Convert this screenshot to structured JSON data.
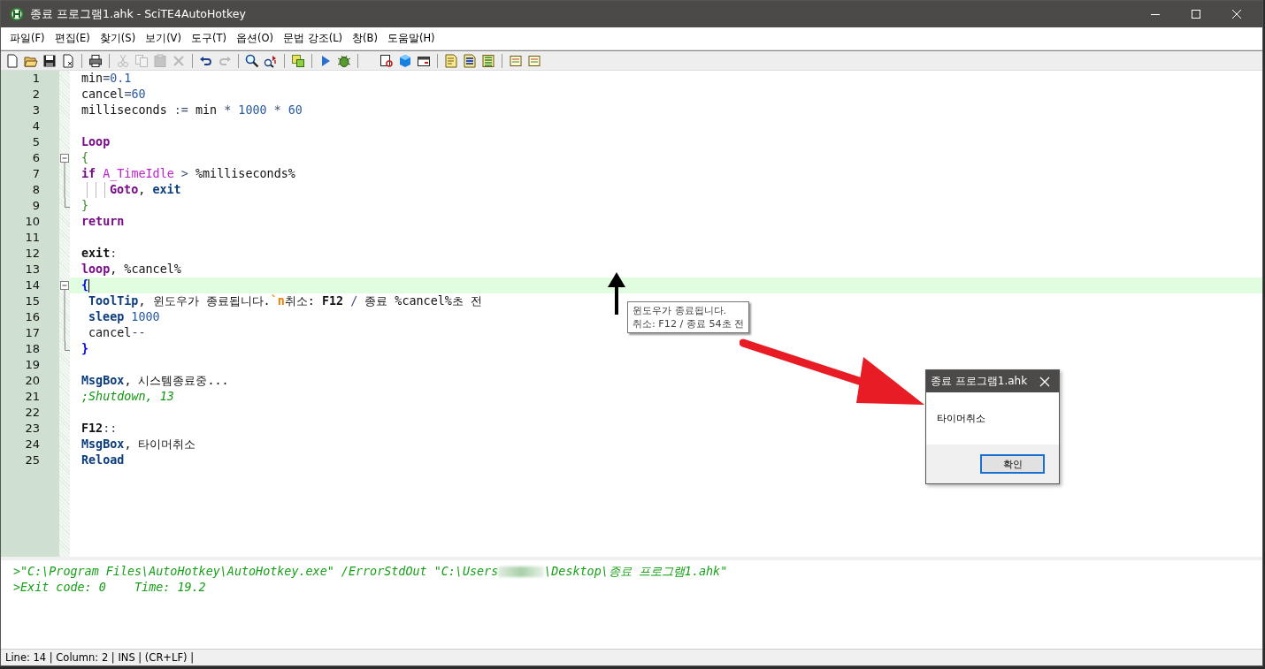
{
  "window": {
    "title": "종료 프로그램1.ahk - SciTE4AutoHotkey"
  },
  "menu": [
    "파일(F)",
    "편집(E)",
    "찾기(S)",
    "보기(V)",
    "도구(T)",
    "옵션(O)",
    "문법 강조(L)",
    "창(B)",
    "도움말(H)"
  ],
  "toolbar": [
    {
      "kind": "document",
      "disabled": false
    },
    {
      "kind": "folder",
      "disabled": false
    },
    {
      "kind": "floppy",
      "disabled": false
    },
    {
      "kind": "document-x",
      "disabled": false
    },
    {
      "kind": "separator"
    },
    {
      "kind": "printer",
      "disabled": false
    },
    {
      "kind": "separator"
    },
    {
      "kind": "scissors",
      "disabled": true
    },
    {
      "kind": "copy",
      "disabled": true
    },
    {
      "kind": "clipboard",
      "disabled": true
    },
    {
      "kind": "cross",
      "disabled": true
    },
    {
      "kind": "separator"
    },
    {
      "kind": "undo",
      "disabled": false
    },
    {
      "kind": "redo",
      "disabled": true
    },
    {
      "kind": "separator"
    },
    {
      "kind": "magnifier",
      "disabled": false
    },
    {
      "kind": "replace",
      "disabled": false
    },
    {
      "kind": "separator"
    },
    {
      "kind": "pages",
      "disabled": false
    },
    {
      "kind": "separator"
    },
    {
      "kind": "play",
      "disabled": false
    },
    {
      "kind": "bug",
      "disabled": false
    },
    {
      "kind": "separator"
    },
    {
      "kind": "gap"
    },
    {
      "kind": "page-magnifier",
      "disabled": false
    },
    {
      "kind": "cube",
      "disabled": false
    },
    {
      "kind": "card",
      "disabled": false
    },
    {
      "kind": "separator"
    },
    {
      "kind": "note",
      "disabled": false
    },
    {
      "kind": "note-lines",
      "disabled": false
    },
    {
      "kind": "note-list",
      "disabled": false
    },
    {
      "kind": "separator"
    },
    {
      "kind": "sheet",
      "disabled": false
    },
    {
      "kind": "sheet",
      "disabled": false
    }
  ],
  "editor": {
    "lines": [
      {
        "number": "1",
        "current": false,
        "segments": [
          {
            "kind": "plain",
            "text": "min"
          },
          {
            "kind": "op",
            "text": "="
          },
          {
            "kind": "number",
            "text": "0.1"
          }
        ]
      },
      {
        "number": "2",
        "current": false,
        "segments": [
          {
            "kind": "plain",
            "text": "cancel"
          },
          {
            "kind": "op",
            "text": "="
          },
          {
            "kind": "number",
            "text": "60"
          }
        ]
      },
      {
        "number": "3",
        "current": false,
        "segments": [
          {
            "kind": "plain",
            "text": "milliseconds "
          },
          {
            "kind": "op",
            "text": ":="
          },
          {
            "kind": "plain",
            "text": " min "
          },
          {
            "kind": "op",
            "text": "*"
          },
          {
            "kind": "number",
            "text": " 1000 "
          },
          {
            "kind": "op",
            "text": "*"
          },
          {
            "kind": "number",
            "text": " 60"
          }
        ]
      },
      {
        "number": "4",
        "current": false
      },
      {
        "number": "5",
        "current": false,
        "segments": [
          {
            "kind": "flow",
            "text": "Loop"
          }
        ]
      },
      {
        "number": "6",
        "fold_expanded": true,
        "current": false,
        "segments": [
          {
            "kind": "brace",
            "text": "{"
          }
        ]
      },
      {
        "number": "7",
        "fold_line": true,
        "current": false,
        "segments": [
          {
            "kind": "flow",
            "text": "if"
          },
          {
            "kind": "var",
            "text": " A_TimeIdle"
          },
          {
            "kind": "op",
            "text": " > "
          },
          {
            "kind": "plain",
            "text": "%milliseconds%"
          }
        ]
      },
      {
        "number": "8",
        "fold_line": true,
        "current": false,
        "guides": true,
        "segments": [
          {
            "kind": "flow",
            "text": "Goto"
          },
          {
            "kind": "plain",
            "text": ", "
          },
          {
            "kind": "command",
            "text": "exit"
          }
        ]
      },
      {
        "number": "9",
        "fold_end": true,
        "current": false,
        "segments": [
          {
            "kind": "brace",
            "text": "}"
          }
        ]
      },
      {
        "number": "10",
        "current": false,
        "segments": [
          {
            "kind": "flow",
            "text": "return"
          }
        ]
      },
      {
        "number": "11",
        "current": false
      },
      {
        "number": "12",
        "current": false,
        "segments": [
          {
            "kind": "label",
            "text": "exit"
          },
          {
            "kind": "op",
            "text": ":"
          }
        ]
      },
      {
        "number": "13",
        "current": false,
        "segments": [
          {
            "kind": "flow",
            "text": "loop"
          },
          {
            "kind": "plain",
            "text": ", %cancel%"
          }
        ]
      },
      {
        "number": "14",
        "fold_expanded": true,
        "current": true,
        "segments": [
          {
            "kind": "bracematch",
            "text": "{"
          }
        ]
      },
      {
        "number": "15",
        "fold_line": true,
        "current": false,
        "indented": true,
        "segments": [
          {
            "kind": "command",
            "text": "ToolTip"
          },
          {
            "kind": "plain",
            "text": ", 윈도우가 종료됩니다."
          },
          {
            "kind": "escape",
            "text": "`n"
          },
          {
            "kind": "plain",
            "text": "취소: "
          },
          {
            "kind": "label",
            "text": "F12"
          },
          {
            "kind": "op",
            "text": " / "
          },
          {
            "kind": "plain",
            "text": "종료 %cancel%초 전"
          }
        ]
      },
      {
        "number": "16",
        "fold_line": true,
        "current": false,
        "indented": true,
        "segments": [
          {
            "kind": "command",
            "text": "sleep"
          },
          {
            "kind": "number",
            "text": " 1000"
          }
        ]
      },
      {
        "number": "17",
        "fold_line": true,
        "current": false,
        "indented": true,
        "segments": [
          {
            "kind": "plain",
            "text": "cancel"
          },
          {
            "kind": "op",
            "text": "--"
          }
        ]
      },
      {
        "number": "18",
        "fold_end": true,
        "current": false,
        "segments": [
          {
            "kind": "bracematch",
            "text": "}"
          }
        ]
      },
      {
        "number": "19",
        "current": false
      },
      {
        "number": "20",
        "current": false,
        "segments": [
          {
            "kind": "command",
            "text": "MsgBox"
          },
          {
            "kind": "plain",
            "text": ", 시스템종료중..."
          }
        ]
      },
      {
        "number": "21",
        "current": false,
        "segments": [
          {
            "kind": "comment",
            "text": ";Shutdown, 13"
          }
        ]
      },
      {
        "number": "22",
        "current": false
      },
      {
        "number": "23",
        "current": false,
        "segments": [
          {
            "kind": "label",
            "text": "F12"
          },
          {
            "kind": "op",
            "text": "::"
          }
        ]
      },
      {
        "number": "24",
        "current": false,
        "segments": [
          {
            "kind": "command",
            "text": "MsgBox"
          },
          {
            "kind": "plain",
            "text": ", 타이머취소"
          }
        ]
      },
      {
        "number": "25",
        "current": false,
        "segments": [
          {
            "kind": "command",
            "text": "Reload"
          }
        ]
      }
    ]
  },
  "output": [
    [
      {
        "kind": "text",
        "text": ">\"C:\\Program Files\\AutoHotkey\\AutoHotkey.exe\" /ErrorStdOut \"C:\\Users"
      },
      {
        "kind": "blurred"
      },
      {
        "kind": "text",
        "text": "\\Desktop\\종료 프로그램1.ahk\""
      }
    ],
    [
      {
        "kind": "text",
        "text": ">Exit code: 0    Time: 19.2"
      }
    ]
  ],
  "status_bar": "Line: 14 | Column: 2 | INS | (CR+LF) |",
  "tooltip": [
    "윈도우가 종료됩니다.",
    "취소: F12 / 종료 54초 전"
  ],
  "message_box": {
    "title": "종료 프로그램1.ahk",
    "message": "타이머취소",
    "button": "확인"
  }
}
